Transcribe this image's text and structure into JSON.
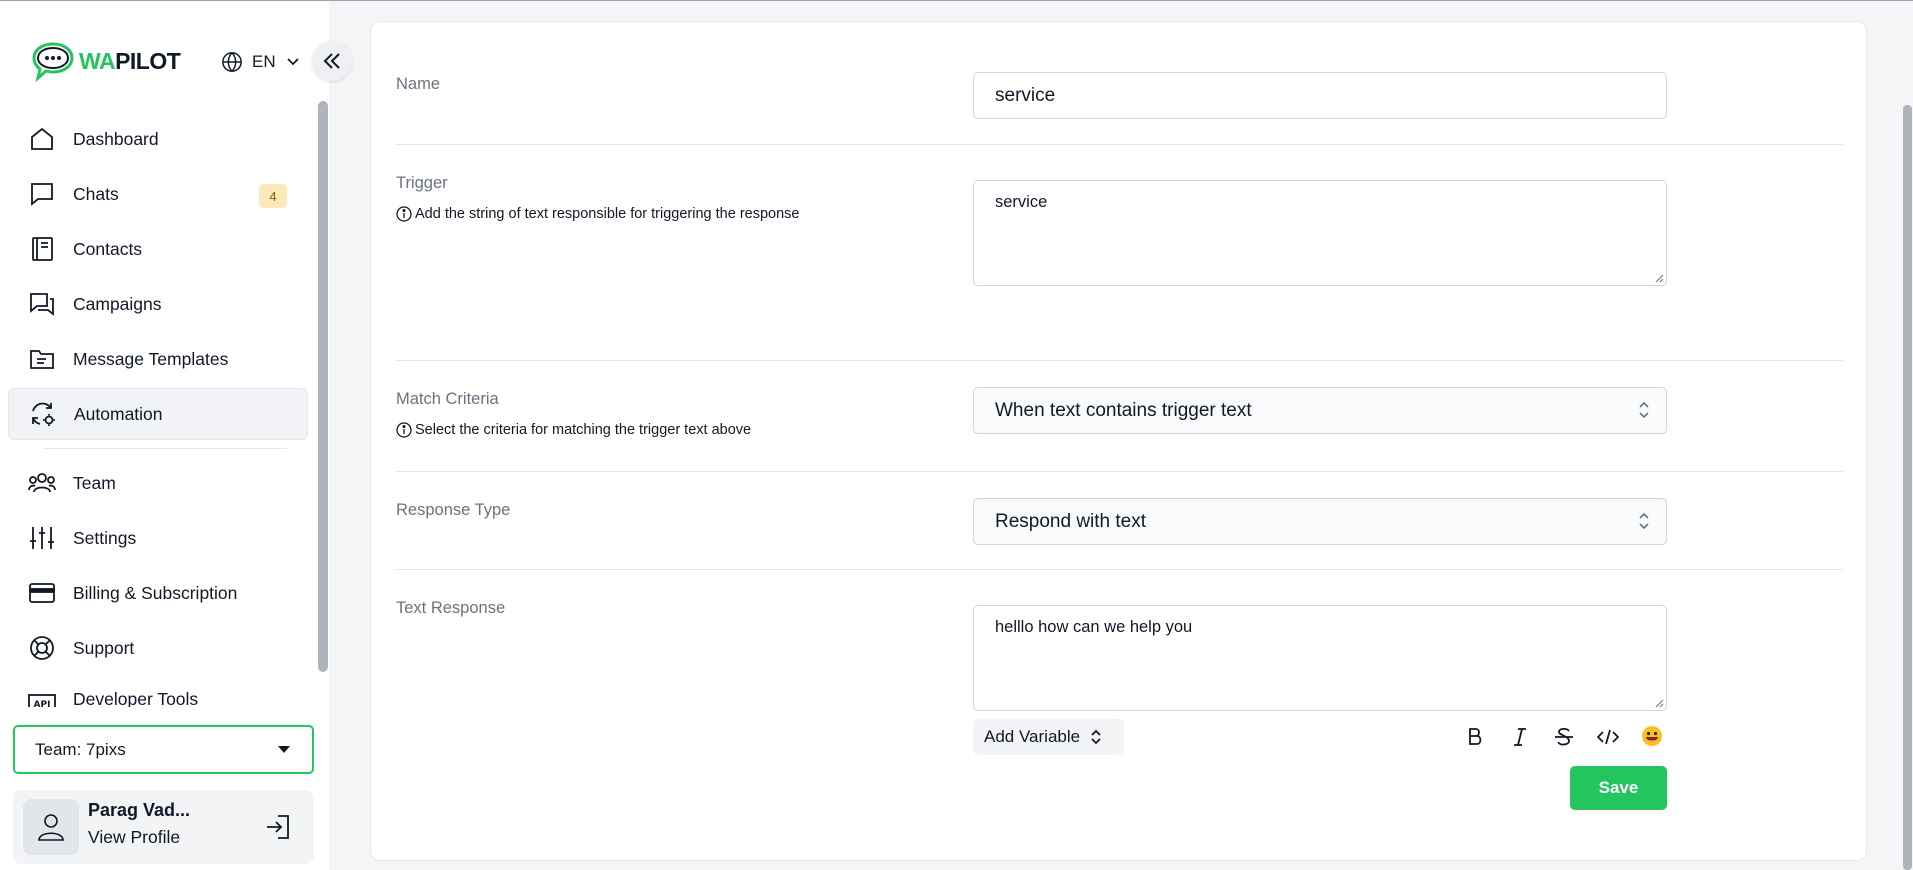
{
  "brand": {
    "wa": "WA",
    "pilot": "PILOT"
  },
  "language": {
    "label": "EN"
  },
  "sidebar": {
    "items": [
      {
        "label": "Dashboard",
        "icon": "home-icon"
      },
      {
        "label": "Chats",
        "icon": "chat-icon",
        "badge": "4"
      },
      {
        "label": "Contacts",
        "icon": "contacts-book-icon"
      },
      {
        "label": "Campaigns",
        "icon": "campaigns-icon"
      },
      {
        "label": "Message Templates",
        "icon": "template-folder-icon"
      },
      {
        "label": "Automation",
        "icon": "automation-icon",
        "active": true
      },
      {
        "label": "Team",
        "icon": "team-icon"
      },
      {
        "label": "Settings",
        "icon": "sliders-icon"
      },
      {
        "label": "Billing & Subscription",
        "icon": "credit-card-icon"
      },
      {
        "label": "Support",
        "icon": "lifebuoy-icon"
      },
      {
        "label": "Developer Tools",
        "icon": "api-icon"
      }
    ]
  },
  "team_select": {
    "value": "Team: 7pixs"
  },
  "profile": {
    "name": "Parag Vad...",
    "link": "View Profile"
  },
  "form": {
    "name": {
      "label": "Name",
      "value": "service"
    },
    "trigger": {
      "label": "Trigger",
      "hint": "Add the string of text responsible for triggering the response",
      "value": "service"
    },
    "match_criteria": {
      "label": "Match Criteria",
      "hint": "Select the criteria for matching the trigger text above",
      "value": "When text contains trigger text"
    },
    "response_type": {
      "label": "Response Type",
      "value": "Respond with text"
    },
    "text_response": {
      "label": "Text Response",
      "value": "helllo how can we help you"
    },
    "add_variable": "Add Variable",
    "save": "Save"
  },
  "colors": {
    "accent": "#22c55e",
    "badge_bg": "#fde8b8"
  }
}
